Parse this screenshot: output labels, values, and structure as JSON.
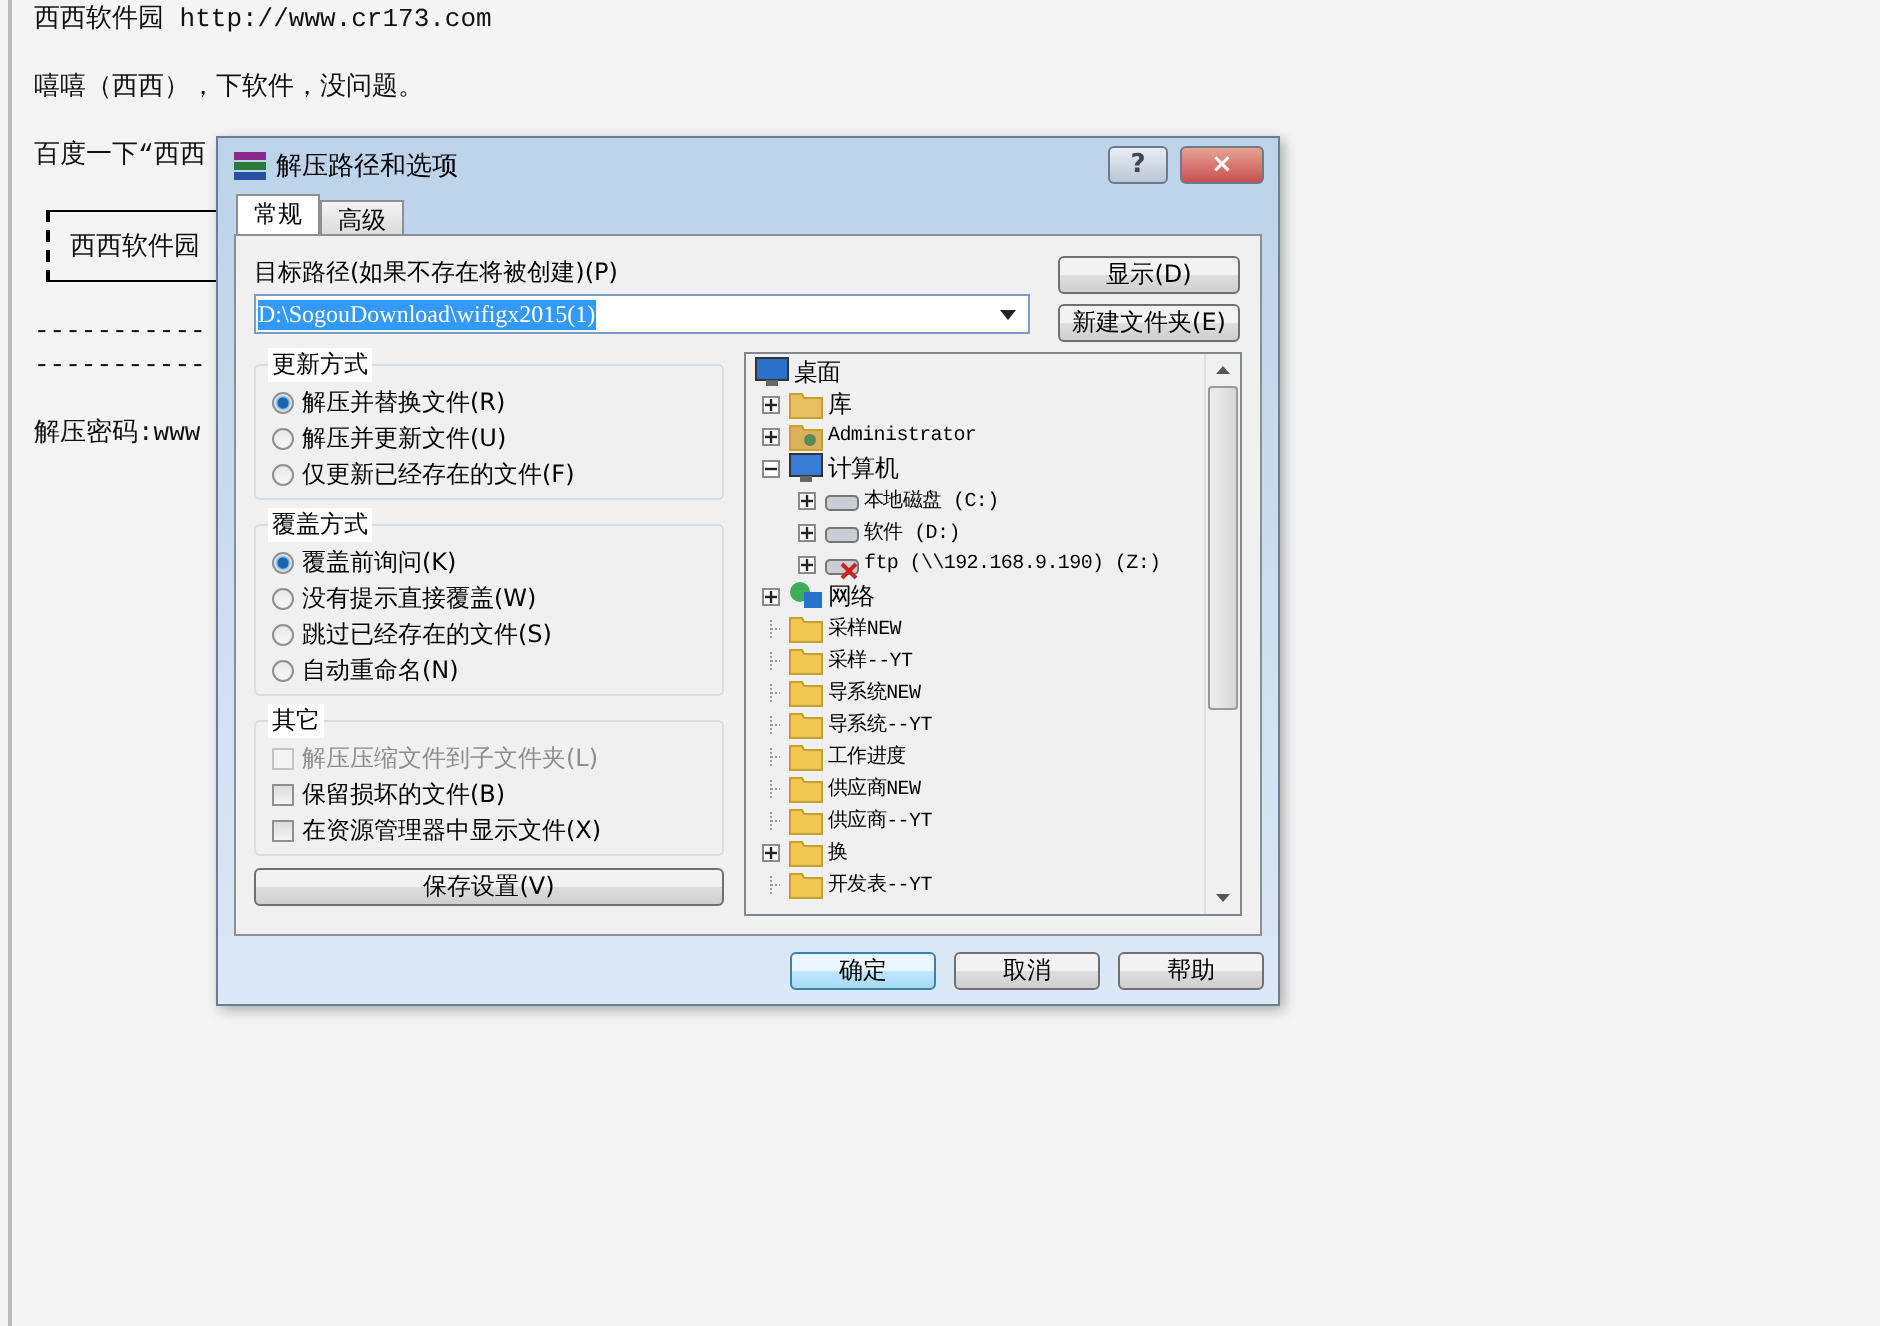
{
  "background": {
    "lines": [
      {
        "kind": "text",
        "text": "西西软件园 http://www.cr173.com"
      },
      {
        "kind": "text",
        "text": "嘻嘻（西西），下软件，没问题。"
      },
      {
        "kind": "text",
        "text": "百度一下“西西"
      },
      {
        "kind": "boxed",
        "text": "西西软件园"
      },
      {
        "kind": "dashes",
        "text": "-----------"
      },
      {
        "kind": "dashes",
        "text": "-----------"
      },
      {
        "kind": "text",
        "text": "解压密码:www"
      }
    ]
  },
  "dialog": {
    "title": "解压路径和选项",
    "help_button": "?",
    "close_button": "×",
    "tabs": [
      {
        "label": "常规",
        "selected": true
      },
      {
        "label": "高级",
        "selected": false
      }
    ],
    "path_label": "目标路径(如果不存在将被创建)(P)",
    "path_value": "D:\\SogouDownload\\wifigx2015(1)",
    "side_buttons": [
      "显示(D)",
      "新建文件夹(E)"
    ],
    "groups": [
      {
        "title": "更新方式",
        "kind": "radio",
        "options": [
          {
            "label": "解压并替换文件(R)",
            "selected": true
          },
          {
            "label": "解压并更新文件(U)",
            "selected": false
          },
          {
            "label": "仅更新已经存在的文件(F)",
            "selected": false
          }
        ]
      },
      {
        "title": "覆盖方式",
        "kind": "radio",
        "options": [
          {
            "label": "覆盖前询问(K)",
            "selected": true
          },
          {
            "label": "没有提示直接覆盖(W)",
            "selected": false
          },
          {
            "label": "跳过已经存在的文件(S)",
            "selected": false
          },
          {
            "label": "自动重命名(N)",
            "selected": false
          }
        ]
      },
      {
        "title": "其它",
        "kind": "checkbox",
        "options": [
          {
            "label": "解压压缩文件到子文件夹(L)",
            "checked": false,
            "disabled": true
          },
          {
            "label": "保留损坏的文件(B)",
            "checked": false,
            "disabled": false
          },
          {
            "label": "在资源管理器中显示文件(X)",
            "checked": false,
            "disabled": false
          }
        ]
      }
    ],
    "save_button": "保存设置(V)",
    "tree": [
      {
        "label": "桌面",
        "kind": "desktop",
        "children": [
          {
            "label": "库",
            "kind": "library",
            "expandable": true,
            "expanded": false
          },
          {
            "label": "Administrator",
            "kind": "user",
            "expandable": true,
            "expanded": false
          },
          {
            "label": "计算机",
            "kind": "computer",
            "expandable": true,
            "expanded": true,
            "children": [
              {
                "label": "本地磁盘 (C:)",
                "kind": "drive",
                "expandable": true,
                "expanded": false
              },
              {
                "label": "软件 (D:)",
                "kind": "drive",
                "expandable": true,
                "expanded": false
              },
              {
                "label": "ftp (\\\\192.168.9.190) (Z:)",
                "kind": "netdrive",
                "expandable": true,
                "expanded": false
              }
            ]
          },
          {
            "label": "网络",
            "kind": "network",
            "expandable": true,
            "expanded": false
          },
          {
            "label": "采样NEW",
            "kind": "folder",
            "expandable": false
          },
          {
            "label": "采样--YT",
            "kind": "folder",
            "expandable": false
          },
          {
            "label": "导系统NEW",
            "kind": "folder",
            "expandable": false
          },
          {
            "label": "导系统--YT",
            "kind": "folder",
            "expandable": false
          },
          {
            "label": "工作进度",
            "kind": "folder",
            "expandable": false
          },
          {
            "label": "供应商NEW",
            "kind": "folder",
            "expandable": false
          },
          {
            "label": "供应商--YT",
            "kind": "folder",
            "expandable": false
          },
          {
            "label": "换",
            "kind": "folder",
            "expandable": true,
            "expanded": false
          },
          {
            "label": "开发表--YT",
            "kind": "folder",
            "expandable": false
          }
        ]
      }
    ],
    "footer_buttons": [
      {
        "label": "确定",
        "kind": "default"
      },
      {
        "label": "取消",
        "kind": "normal"
      },
      {
        "label": "帮助",
        "kind": "normal"
      }
    ]
  }
}
